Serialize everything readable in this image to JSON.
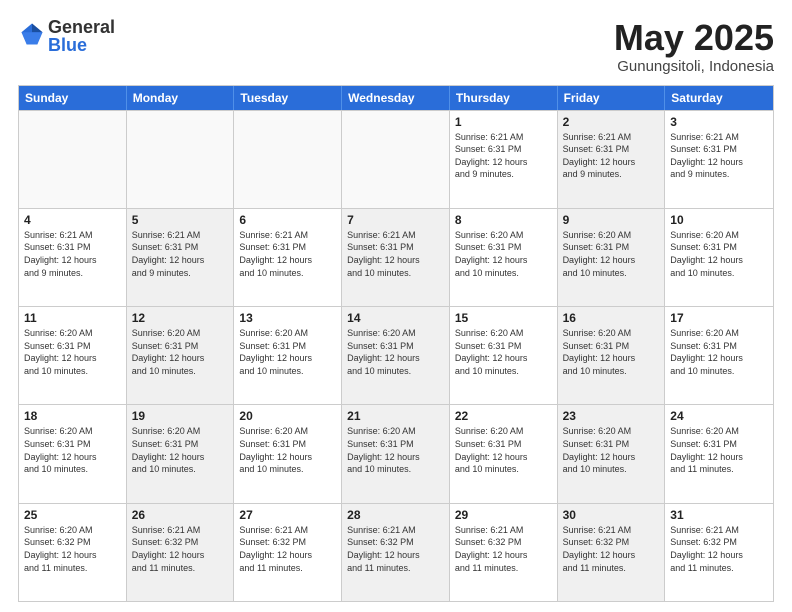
{
  "header": {
    "logo_general": "General",
    "logo_blue": "Blue",
    "title": "May 2025",
    "subtitle": "Gunungsitoli, Indonesia"
  },
  "calendar": {
    "days_of_week": [
      "Sunday",
      "Monday",
      "Tuesday",
      "Wednesday",
      "Thursday",
      "Friday",
      "Saturday"
    ],
    "weeks": [
      [
        {
          "day": "",
          "info": "",
          "empty": true
        },
        {
          "day": "",
          "info": "",
          "empty": true
        },
        {
          "day": "",
          "info": "",
          "empty": true
        },
        {
          "day": "",
          "info": "",
          "empty": true
        },
        {
          "day": "1",
          "info": "Sunrise: 6:21 AM\nSunset: 6:31 PM\nDaylight: 12 hours\nand 9 minutes."
        },
        {
          "day": "2",
          "info": "Sunrise: 6:21 AM\nSunset: 6:31 PM\nDaylight: 12 hours\nand 9 minutes.",
          "shaded": true
        },
        {
          "day": "3",
          "info": "Sunrise: 6:21 AM\nSunset: 6:31 PM\nDaylight: 12 hours\nand 9 minutes."
        }
      ],
      [
        {
          "day": "4",
          "info": "Sunrise: 6:21 AM\nSunset: 6:31 PM\nDaylight: 12 hours\nand 9 minutes."
        },
        {
          "day": "5",
          "info": "Sunrise: 6:21 AM\nSunset: 6:31 PM\nDaylight: 12 hours\nand 9 minutes.",
          "shaded": true
        },
        {
          "day": "6",
          "info": "Sunrise: 6:21 AM\nSunset: 6:31 PM\nDaylight: 12 hours\nand 10 minutes."
        },
        {
          "day": "7",
          "info": "Sunrise: 6:21 AM\nSunset: 6:31 PM\nDaylight: 12 hours\nand 10 minutes.",
          "shaded": true
        },
        {
          "day": "8",
          "info": "Sunrise: 6:20 AM\nSunset: 6:31 PM\nDaylight: 12 hours\nand 10 minutes."
        },
        {
          "day": "9",
          "info": "Sunrise: 6:20 AM\nSunset: 6:31 PM\nDaylight: 12 hours\nand 10 minutes.",
          "shaded": true
        },
        {
          "day": "10",
          "info": "Sunrise: 6:20 AM\nSunset: 6:31 PM\nDaylight: 12 hours\nand 10 minutes."
        }
      ],
      [
        {
          "day": "11",
          "info": "Sunrise: 6:20 AM\nSunset: 6:31 PM\nDaylight: 12 hours\nand 10 minutes."
        },
        {
          "day": "12",
          "info": "Sunrise: 6:20 AM\nSunset: 6:31 PM\nDaylight: 12 hours\nand 10 minutes.",
          "shaded": true
        },
        {
          "day": "13",
          "info": "Sunrise: 6:20 AM\nSunset: 6:31 PM\nDaylight: 12 hours\nand 10 minutes."
        },
        {
          "day": "14",
          "info": "Sunrise: 6:20 AM\nSunset: 6:31 PM\nDaylight: 12 hours\nand 10 minutes.",
          "shaded": true
        },
        {
          "day": "15",
          "info": "Sunrise: 6:20 AM\nSunset: 6:31 PM\nDaylight: 12 hours\nand 10 minutes."
        },
        {
          "day": "16",
          "info": "Sunrise: 6:20 AM\nSunset: 6:31 PM\nDaylight: 12 hours\nand 10 minutes.",
          "shaded": true
        },
        {
          "day": "17",
          "info": "Sunrise: 6:20 AM\nSunset: 6:31 PM\nDaylight: 12 hours\nand 10 minutes."
        }
      ],
      [
        {
          "day": "18",
          "info": "Sunrise: 6:20 AM\nSunset: 6:31 PM\nDaylight: 12 hours\nand 10 minutes."
        },
        {
          "day": "19",
          "info": "Sunrise: 6:20 AM\nSunset: 6:31 PM\nDaylight: 12 hours\nand 10 minutes.",
          "shaded": true
        },
        {
          "day": "20",
          "info": "Sunrise: 6:20 AM\nSunset: 6:31 PM\nDaylight: 12 hours\nand 10 minutes."
        },
        {
          "day": "21",
          "info": "Sunrise: 6:20 AM\nSunset: 6:31 PM\nDaylight: 12 hours\nand 10 minutes.",
          "shaded": true
        },
        {
          "day": "22",
          "info": "Sunrise: 6:20 AM\nSunset: 6:31 PM\nDaylight: 12 hours\nand 10 minutes."
        },
        {
          "day": "23",
          "info": "Sunrise: 6:20 AM\nSunset: 6:31 PM\nDaylight: 12 hours\nand 10 minutes.",
          "shaded": true
        },
        {
          "day": "24",
          "info": "Sunrise: 6:20 AM\nSunset: 6:31 PM\nDaylight: 12 hours\nand 11 minutes."
        }
      ],
      [
        {
          "day": "25",
          "info": "Sunrise: 6:20 AM\nSunset: 6:32 PM\nDaylight: 12 hours\nand 11 minutes."
        },
        {
          "day": "26",
          "info": "Sunrise: 6:21 AM\nSunset: 6:32 PM\nDaylight: 12 hours\nand 11 minutes.",
          "shaded": true
        },
        {
          "day": "27",
          "info": "Sunrise: 6:21 AM\nSunset: 6:32 PM\nDaylight: 12 hours\nand 11 minutes."
        },
        {
          "day": "28",
          "info": "Sunrise: 6:21 AM\nSunset: 6:32 PM\nDaylight: 12 hours\nand 11 minutes.",
          "shaded": true
        },
        {
          "day": "29",
          "info": "Sunrise: 6:21 AM\nSunset: 6:32 PM\nDaylight: 12 hours\nand 11 minutes."
        },
        {
          "day": "30",
          "info": "Sunrise: 6:21 AM\nSunset: 6:32 PM\nDaylight: 12 hours\nand 11 minutes.",
          "shaded": true
        },
        {
          "day": "31",
          "info": "Sunrise: 6:21 AM\nSunset: 6:32 PM\nDaylight: 12 hours\nand 11 minutes."
        }
      ]
    ]
  }
}
